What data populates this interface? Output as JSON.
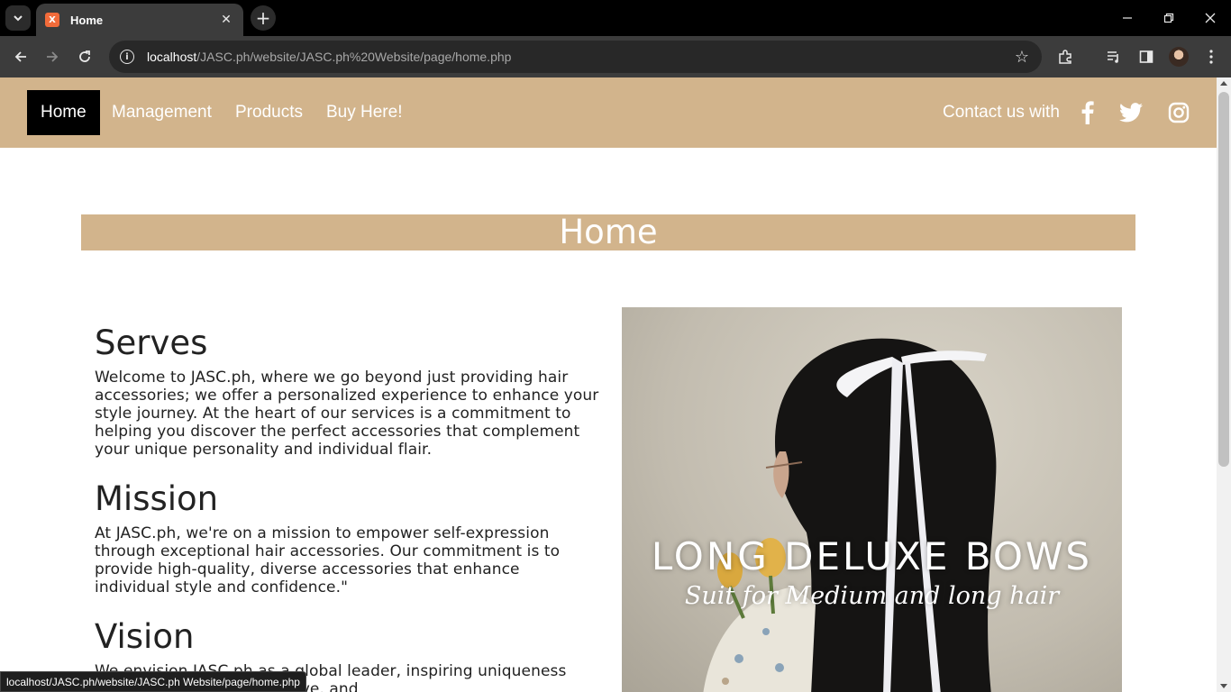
{
  "browser": {
    "tab_title": "Home",
    "tab_favicon": "X",
    "url_host": "localhost",
    "url_path": "/JASC.ph/website/JASC.ph%20Website/page/home.php",
    "status_url": "localhost/JASC.ph/website/JASC.ph Website/page/home.php"
  },
  "nav": {
    "items": [
      "Home",
      "Management",
      "Products",
      "Buy Here!"
    ],
    "contact_label": "Contact us with",
    "accent_color": "#d2b48c"
  },
  "page": {
    "banner_title": "Home",
    "sections": [
      {
        "heading": "Serves",
        "text": "Welcome to JASC.ph, where we go beyond just providing hair accessories; we offer a personalized experience to enhance your style journey. At the heart of our services is a commitment to helping you discover the perfect accessories that complement your unique personality and individual flair."
      },
      {
        "heading": "Mission",
        "text": "At JASC.ph, we're on a mission to empower self-expression through exceptional hair accessories. Our commitment is to provide high-quality, diverse accessories that enhance individual style and confidence.\""
      },
      {
        "heading": "Vision",
        "text": "We envision JASC.ph as a global leader, inspiring uniqueness through innovative, inclusive, and"
      }
    ],
    "hero": {
      "title": "LONG DELUXE BOWS",
      "subtitle": "Suit for Medium and long hair"
    }
  }
}
